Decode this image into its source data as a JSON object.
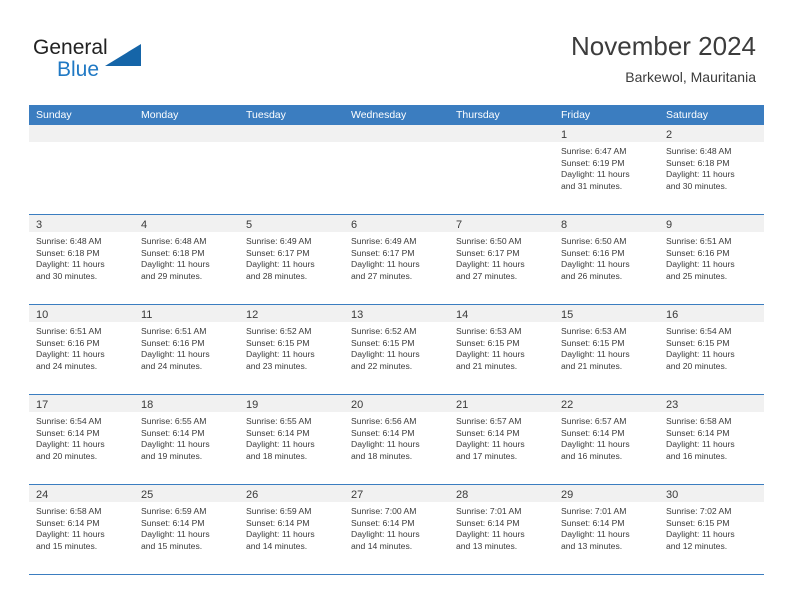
{
  "brand": {
    "name_part1": "General",
    "name_part2": "Blue",
    "logo_icon": "triangle-logo-icon",
    "accent_color": "#2079c4"
  },
  "header": {
    "month_title": "November 2024",
    "location": "Barkewol, Mauritania"
  },
  "theme": {
    "header_blue": "#3b7dc0",
    "daynum_band_gray": "#f1f1f1",
    "text_color": "#3a3a3a"
  },
  "calendar": {
    "weekday_headers": [
      "Sunday",
      "Monday",
      "Tuesday",
      "Wednesday",
      "Thursday",
      "Friday",
      "Saturday"
    ],
    "weeks": [
      [
        {
          "day": "",
          "lines": []
        },
        {
          "day": "",
          "lines": []
        },
        {
          "day": "",
          "lines": []
        },
        {
          "day": "",
          "lines": []
        },
        {
          "day": "",
          "lines": []
        },
        {
          "day": "1",
          "lines": [
            "Sunrise: 6:47 AM",
            "Sunset: 6:19 PM",
            "Daylight: 11 hours",
            "and 31 minutes."
          ]
        },
        {
          "day": "2",
          "lines": [
            "Sunrise: 6:48 AM",
            "Sunset: 6:18 PM",
            "Daylight: 11 hours",
            "and 30 minutes."
          ]
        }
      ],
      [
        {
          "day": "3",
          "lines": [
            "Sunrise: 6:48 AM",
            "Sunset: 6:18 PM",
            "Daylight: 11 hours",
            "and 30 minutes."
          ]
        },
        {
          "day": "4",
          "lines": [
            "Sunrise: 6:48 AM",
            "Sunset: 6:18 PM",
            "Daylight: 11 hours",
            "and 29 minutes."
          ]
        },
        {
          "day": "5",
          "lines": [
            "Sunrise: 6:49 AM",
            "Sunset: 6:17 PM",
            "Daylight: 11 hours",
            "and 28 minutes."
          ]
        },
        {
          "day": "6",
          "lines": [
            "Sunrise: 6:49 AM",
            "Sunset: 6:17 PM",
            "Daylight: 11 hours",
            "and 27 minutes."
          ]
        },
        {
          "day": "7",
          "lines": [
            "Sunrise: 6:50 AM",
            "Sunset: 6:17 PM",
            "Daylight: 11 hours",
            "and 27 minutes."
          ]
        },
        {
          "day": "8",
          "lines": [
            "Sunrise: 6:50 AM",
            "Sunset: 6:16 PM",
            "Daylight: 11 hours",
            "and 26 minutes."
          ]
        },
        {
          "day": "9",
          "lines": [
            "Sunrise: 6:51 AM",
            "Sunset: 6:16 PM",
            "Daylight: 11 hours",
            "and 25 minutes."
          ]
        }
      ],
      [
        {
          "day": "10",
          "lines": [
            "Sunrise: 6:51 AM",
            "Sunset: 6:16 PM",
            "Daylight: 11 hours",
            "and 24 minutes."
          ]
        },
        {
          "day": "11",
          "lines": [
            "Sunrise: 6:51 AM",
            "Sunset: 6:16 PM",
            "Daylight: 11 hours",
            "and 24 minutes."
          ]
        },
        {
          "day": "12",
          "lines": [
            "Sunrise: 6:52 AM",
            "Sunset: 6:15 PM",
            "Daylight: 11 hours",
            "and 23 minutes."
          ]
        },
        {
          "day": "13",
          "lines": [
            "Sunrise: 6:52 AM",
            "Sunset: 6:15 PM",
            "Daylight: 11 hours",
            "and 22 minutes."
          ]
        },
        {
          "day": "14",
          "lines": [
            "Sunrise: 6:53 AM",
            "Sunset: 6:15 PM",
            "Daylight: 11 hours",
            "and 21 minutes."
          ]
        },
        {
          "day": "15",
          "lines": [
            "Sunrise: 6:53 AM",
            "Sunset: 6:15 PM",
            "Daylight: 11 hours",
            "and 21 minutes."
          ]
        },
        {
          "day": "16",
          "lines": [
            "Sunrise: 6:54 AM",
            "Sunset: 6:15 PM",
            "Daylight: 11 hours",
            "and 20 minutes."
          ]
        }
      ],
      [
        {
          "day": "17",
          "lines": [
            "Sunrise: 6:54 AM",
            "Sunset: 6:14 PM",
            "Daylight: 11 hours",
            "and 20 minutes."
          ]
        },
        {
          "day": "18",
          "lines": [
            "Sunrise: 6:55 AM",
            "Sunset: 6:14 PM",
            "Daylight: 11 hours",
            "and 19 minutes."
          ]
        },
        {
          "day": "19",
          "lines": [
            "Sunrise: 6:55 AM",
            "Sunset: 6:14 PM",
            "Daylight: 11 hours",
            "and 18 minutes."
          ]
        },
        {
          "day": "20",
          "lines": [
            "Sunrise: 6:56 AM",
            "Sunset: 6:14 PM",
            "Daylight: 11 hours",
            "and 18 minutes."
          ]
        },
        {
          "day": "21",
          "lines": [
            "Sunrise: 6:57 AM",
            "Sunset: 6:14 PM",
            "Daylight: 11 hours",
            "and 17 minutes."
          ]
        },
        {
          "day": "22",
          "lines": [
            "Sunrise: 6:57 AM",
            "Sunset: 6:14 PM",
            "Daylight: 11 hours",
            "and 16 minutes."
          ]
        },
        {
          "day": "23",
          "lines": [
            "Sunrise: 6:58 AM",
            "Sunset: 6:14 PM",
            "Daylight: 11 hours",
            "and 16 minutes."
          ]
        }
      ],
      [
        {
          "day": "24",
          "lines": [
            "Sunrise: 6:58 AM",
            "Sunset: 6:14 PM",
            "Daylight: 11 hours",
            "and 15 minutes."
          ]
        },
        {
          "day": "25",
          "lines": [
            "Sunrise: 6:59 AM",
            "Sunset: 6:14 PM",
            "Daylight: 11 hours",
            "and 15 minutes."
          ]
        },
        {
          "day": "26",
          "lines": [
            "Sunrise: 6:59 AM",
            "Sunset: 6:14 PM",
            "Daylight: 11 hours",
            "and 14 minutes."
          ]
        },
        {
          "day": "27",
          "lines": [
            "Sunrise: 7:00 AM",
            "Sunset: 6:14 PM",
            "Daylight: 11 hours",
            "and 14 minutes."
          ]
        },
        {
          "day": "28",
          "lines": [
            "Sunrise: 7:01 AM",
            "Sunset: 6:14 PM",
            "Daylight: 11 hours",
            "and 13 minutes."
          ]
        },
        {
          "day": "29",
          "lines": [
            "Sunrise: 7:01 AM",
            "Sunset: 6:14 PM",
            "Daylight: 11 hours",
            "and 13 minutes."
          ]
        },
        {
          "day": "30",
          "lines": [
            "Sunrise: 7:02 AM",
            "Sunset: 6:15 PM",
            "Daylight: 11 hours",
            "and 12 minutes."
          ]
        }
      ]
    ]
  }
}
